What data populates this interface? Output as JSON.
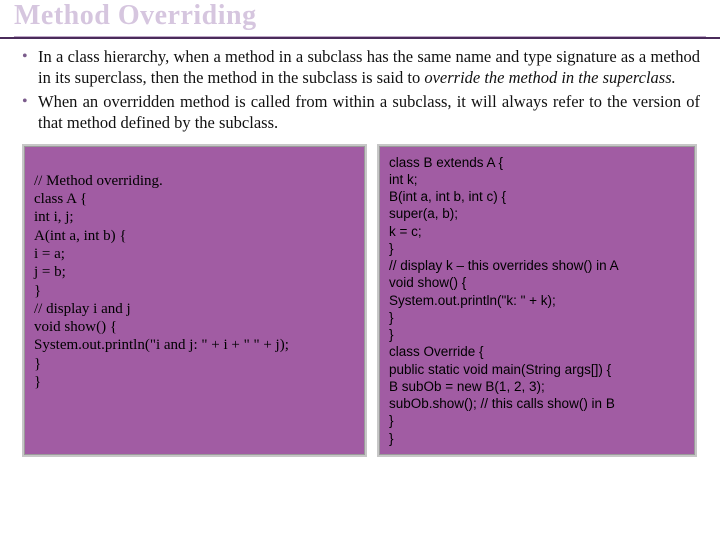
{
  "title": "Method Overriding",
  "bullets": {
    "b1_part1": "In a class hierarchy, when a method in a subclass has the same name and type signature as a method in its superclass, then the method in the subclass is said to ",
    "b1_italic": "override the method in the superclass.",
    "b2": "When an overridden method is called from within a subclass, it will always refer to the version of that method defined by the subclass."
  },
  "code": {
    "left": "\n// Method overriding.\nclass A {\nint i, j;\nA(int a, int b) {\ni = a;\nj = b;\n}\n// display i and j\nvoid show() {\nSystem.out.println(\"i and j: \" + i + \" \" + j);\n}\n}",
    "right": "class B extends A {\nint k;\nB(int a, int b, int c) {\nsuper(a, b);\nk = c;\n}\n// display k – this overrides show() in A\nvoid show() {\nSystem.out.println(\"k: \" + k);\n}\n}\nclass Override {\npublic static void main(String args[]) {\nB subOb = new B(1, 2, 3);\nsubOb.show(); // this calls show() in B\n}\n}"
  }
}
